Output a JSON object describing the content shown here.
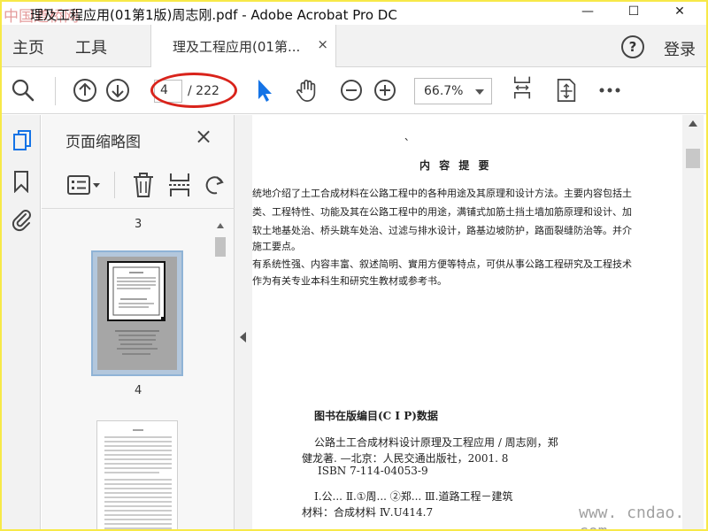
{
  "window": {
    "watermark_top": "中国道桥网",
    "title": "理及工程应用(01第1版)周志刚.pdf - Adobe Acrobat Pro DC",
    "minimize": "—",
    "maximize": "☐",
    "close": "✕"
  },
  "tabs": {
    "home": "主页",
    "tools": "工具",
    "document": "理及工程应用(01第...",
    "document_close": "×",
    "help": "?",
    "login": "登录"
  },
  "toolbar": {
    "page_current": "4",
    "page_total": "/ 222",
    "zoom": "66.7%"
  },
  "panel": {
    "title": "页面缩略图",
    "close": "×",
    "thumbnails": [
      {
        "page": "3"
      },
      {
        "page": "4",
        "selected": true
      }
    ]
  },
  "document": {
    "stray_mark": "、",
    "heading": "内 容 提 要",
    "paragraph_lines": [
      "统地介绍了土工合成材料在公路工程中的各种用途及其原理和设计方法。主要内容包括土",
      "类、工程特性、功能及其在公路工程中的用途，满铺式加筋土挡土墙加筋原理和设计、加",
      "软土地基处治、桥头跳车处治、过滤与排水设计，路基边坡防护，路面裂缝防治等。并介",
      "施工要点。",
      "有系统性强、内容丰富、叙述简明、實用方便等特点，可供从事公路工程研究及工程技术",
      "作为有关专业本科生和研究生教材或参考书。"
    ],
    "cip_title": "图书在版编目(C I P)数据",
    "cip_lines": [
      "公路土工合成材料设计原理及工程应用 / 周志刚，郑",
      "健龙著. —北京：人民交通出版社，2001. 8",
      "ISBN 7-114-04053-9",
      "Ⅰ.公...   Ⅱ.①周...  ②郑...   Ⅲ.道路工程－建筑",
      "材料：合成材料   Ⅳ.U414.7"
    ]
  },
  "watermark_bottom": "www. cndao. com",
  "colors": {
    "border_yellow": "#f7e948",
    "annotation_red": "#d9231b",
    "select_blue": "#1473e6",
    "thumb_selected": "#8fb3d6"
  }
}
